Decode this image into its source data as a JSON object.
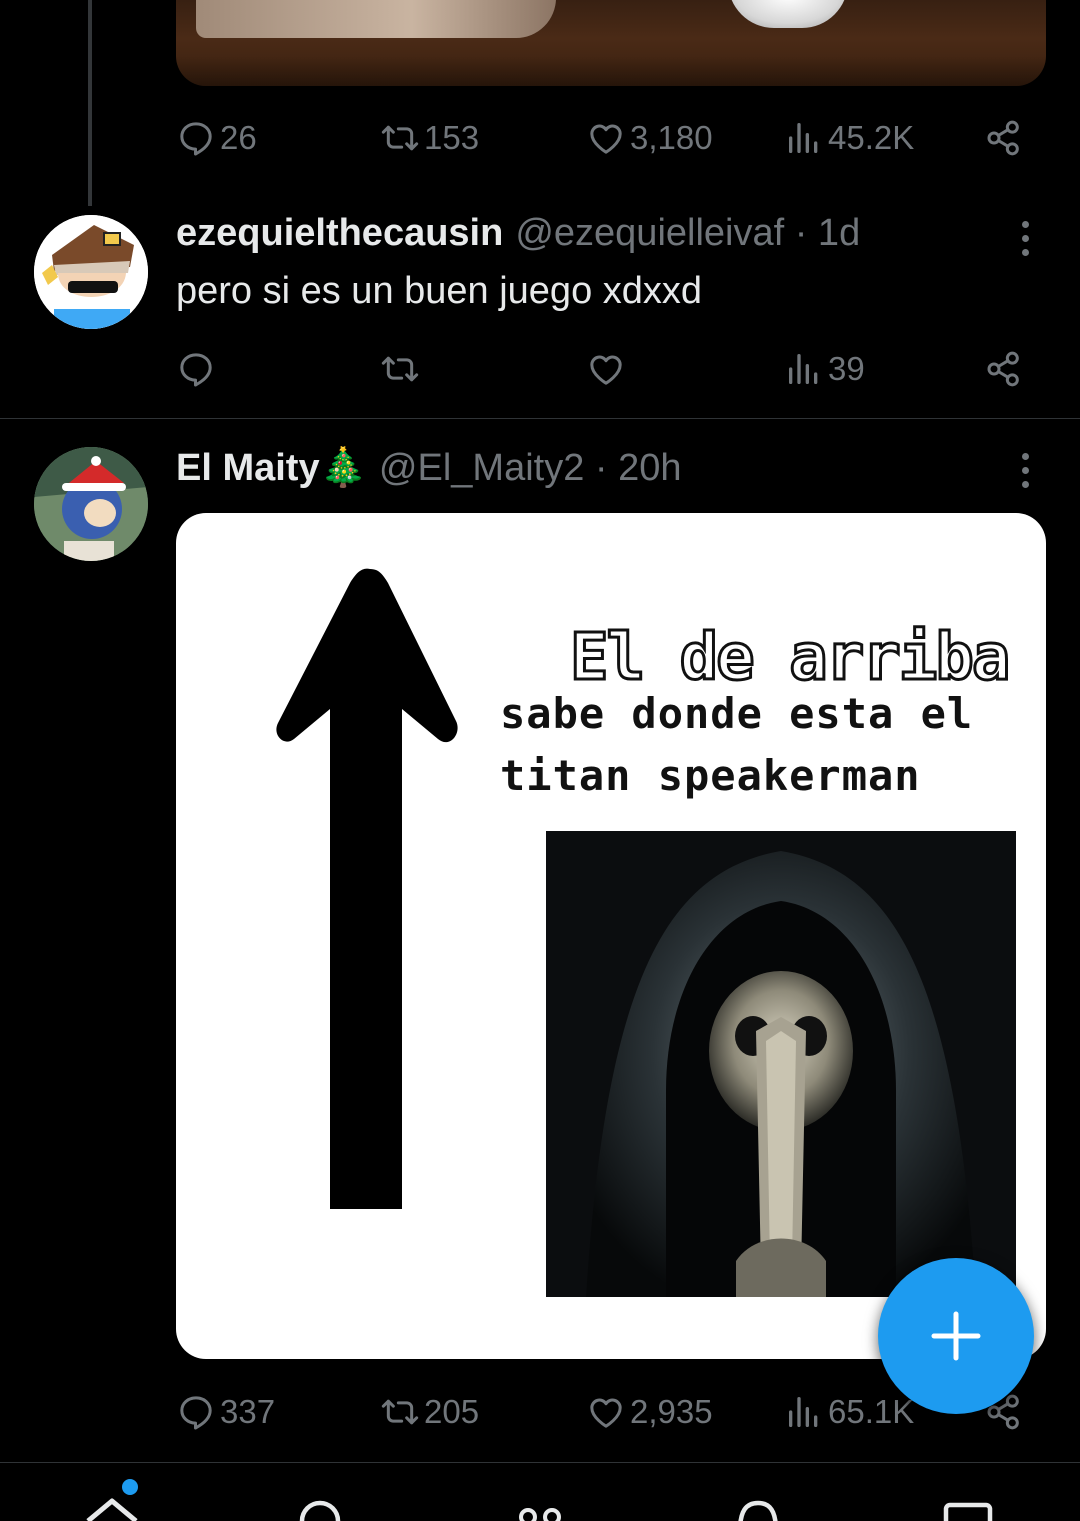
{
  "tweet_prev": {
    "actions": {
      "replies": "26",
      "retweets": "153",
      "likes": "3,180",
      "views": "45.2K"
    }
  },
  "reply": {
    "display_name": "ezequielthecausin",
    "meta": "@ezequielleivaf · 1d",
    "text": "pero si es un buen juego xdxxd",
    "actions": {
      "replies": "",
      "retweets": "",
      "likes": "",
      "views": "39"
    }
  },
  "tweet": {
    "display_name": "El Maity🎄",
    "meta": "@El_Maity2 · 20h",
    "meme": {
      "line1": "El de arriba",
      "line2": "sabe donde esta el",
      "line3": "titan speakerman"
    },
    "actions": {
      "replies": "337",
      "retweets": "205",
      "likes": "2,935",
      "views": "65.1K"
    }
  },
  "colors": {
    "accent": "#1d9bf0",
    "muted": "#71767b",
    "divider": "#2f3336",
    "background": "#000000"
  },
  "icons": [
    "reply-icon",
    "retweet-icon",
    "like-icon",
    "views-icon",
    "share-icon",
    "more-icon",
    "compose-plus-icon",
    "home-icon",
    "search-icon",
    "communities-icon",
    "notifications-icon",
    "messages-icon"
  ]
}
